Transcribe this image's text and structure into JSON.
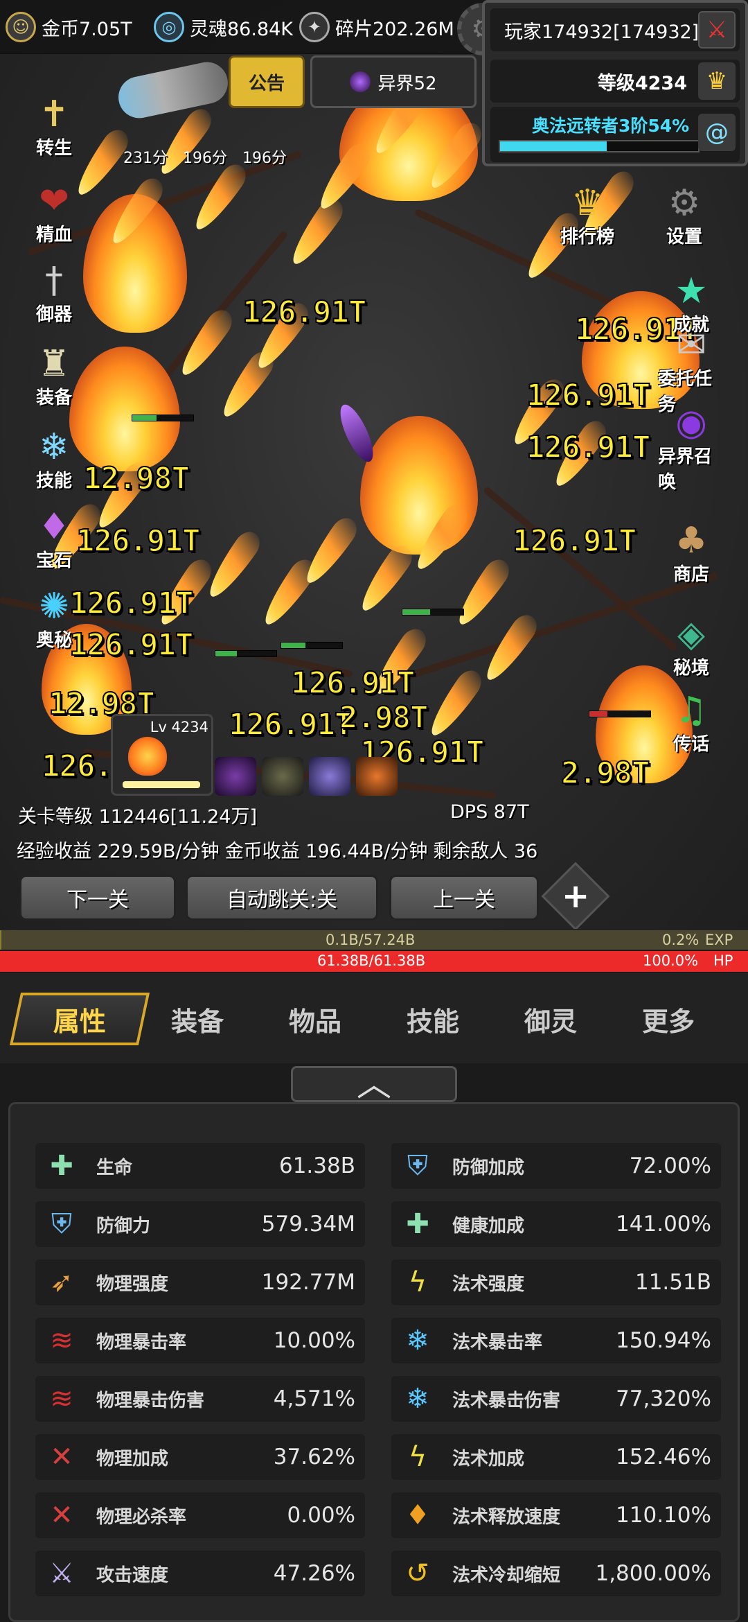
{
  "resources": [
    {
      "name": "gold",
      "label": "金币7.05T",
      "icon": "coin-icon",
      "color": "#e0c46a"
    },
    {
      "name": "soul",
      "label": "灵魂86.84K",
      "icon": "soul-icon",
      "color": "#7fd8ff"
    },
    {
      "name": "shard",
      "label": "碎片202.26M",
      "icon": "shard-icon",
      "color": "#cfcfcf"
    }
  ],
  "player": {
    "name": "玩家174932[174932]",
    "level": "等级4234",
    "title": "奥法远转者3阶54%",
    "progress": 54
  },
  "notice": {
    "label": "公告"
  },
  "otherworld": {
    "label": "异界52"
  },
  "timers": [
    "231分",
    "196分",
    "196分"
  ],
  "left_menu": [
    {
      "label": "转生",
      "icon": "sword-cross-icon"
    },
    {
      "label": "精血",
      "icon": "blood-icon"
    },
    {
      "label": "御器",
      "icon": "sword-icon"
    },
    {
      "label": "装备",
      "icon": "helmet-icon"
    },
    {
      "label": "技能",
      "icon": "ice-crystal-icon"
    },
    {
      "label": "宝石",
      "icon": "gem-bag-icon"
    },
    {
      "label": "奥秘",
      "icon": "swirl-icon"
    }
  ],
  "right_menu": [
    {
      "label": "排行榜",
      "icon": "trophy-icon"
    },
    {
      "label": "设置",
      "icon": "gear-icon"
    },
    {
      "label": "成就",
      "icon": "star-icon"
    },
    {
      "label": "委托任务",
      "icon": "scroll-icon"
    },
    {
      "label": "异界召唤",
      "icon": "portal-icon"
    },
    {
      "label": "商店",
      "icon": "bag-icon"
    },
    {
      "label": "秘境",
      "icon": "mirror-icon"
    },
    {
      "label": "传话",
      "icon": "horn-icon"
    }
  ],
  "damage_numbers": [
    "126.91T",
    "126.91T",
    "126.91T",
    "126.91T",
    "12.98T",
    "126.91T",
    "126.91T",
    "126.91T",
    "12.98T",
    "126.91T",
    "2.98T",
    "126.91T",
    "126.91T",
    "2.98T",
    "126.91T",
    "126.91T"
  ],
  "hero": {
    "level": "Lv 4234"
  },
  "stage": {
    "level": "关卡等级 112446[11.24万]",
    "dps": "DPS 87T",
    "exp_rate": "经验收益 229.59B/分钟",
    "gold_rate": "金币收益 196.44B/分钟",
    "enemies": "剩余敌人 36"
  },
  "buttons": {
    "next": "下一关",
    "auto": "自动跳关:关",
    "prev": "上一关",
    "plus": "+"
  },
  "exp": {
    "value": "0.1B/57.24B",
    "pct": "0.2%",
    "tag": "EXP",
    "fill": 0.2
  },
  "hp": {
    "value": "61.38B/61.38B",
    "pct": "100.0%",
    "tag": "HP",
    "fill": 100
  },
  "tabs": [
    "属性",
    "装备",
    "物品",
    "技能",
    "御灵",
    "更多"
  ],
  "collapse": "︿",
  "stats": [
    {
      "name": "生命",
      "value": "61.38B",
      "icon": "cross-plus-icon"
    },
    {
      "name": "防御加成",
      "value": "72.00%",
      "icon": "shield-icon"
    },
    {
      "name": "防御力",
      "value": "579.34M",
      "icon": "shield-icon"
    },
    {
      "name": "健康加成",
      "value": "141.00%",
      "icon": "cross-plus-icon"
    },
    {
      "name": "物理强度",
      "value": "192.77M",
      "icon": "arrow-icon"
    },
    {
      "name": "法术强度",
      "value": "11.51B",
      "icon": "lightning-icon"
    },
    {
      "name": "物理暴击率",
      "value": "10.00%",
      "icon": "claw-icon"
    },
    {
      "name": "法术暴击率",
      "value": "150.94%",
      "icon": "crystal-icon"
    },
    {
      "name": "物理暴击伤害",
      "value": "4,571%",
      "icon": "claw-icon"
    },
    {
      "name": "法术暴击伤害",
      "value": "77,320%",
      "icon": "crystal-icon"
    },
    {
      "name": "物理加成",
      "value": "37.62%",
      "icon": "slash-icon"
    },
    {
      "name": "法术加成",
      "value": "152.46%",
      "icon": "lightning-icon"
    },
    {
      "name": "物理必杀率",
      "value": "0.00%",
      "icon": "slash-icon"
    },
    {
      "name": "法术释放速度",
      "value": "110.10%",
      "icon": "flame-gem-icon"
    },
    {
      "name": "攻击速度",
      "value": "47.26%",
      "icon": "swords-icon"
    },
    {
      "name": "法术冷却缩短",
      "value": "1,800.00%",
      "icon": "return-arrow-icon"
    }
  ]
}
